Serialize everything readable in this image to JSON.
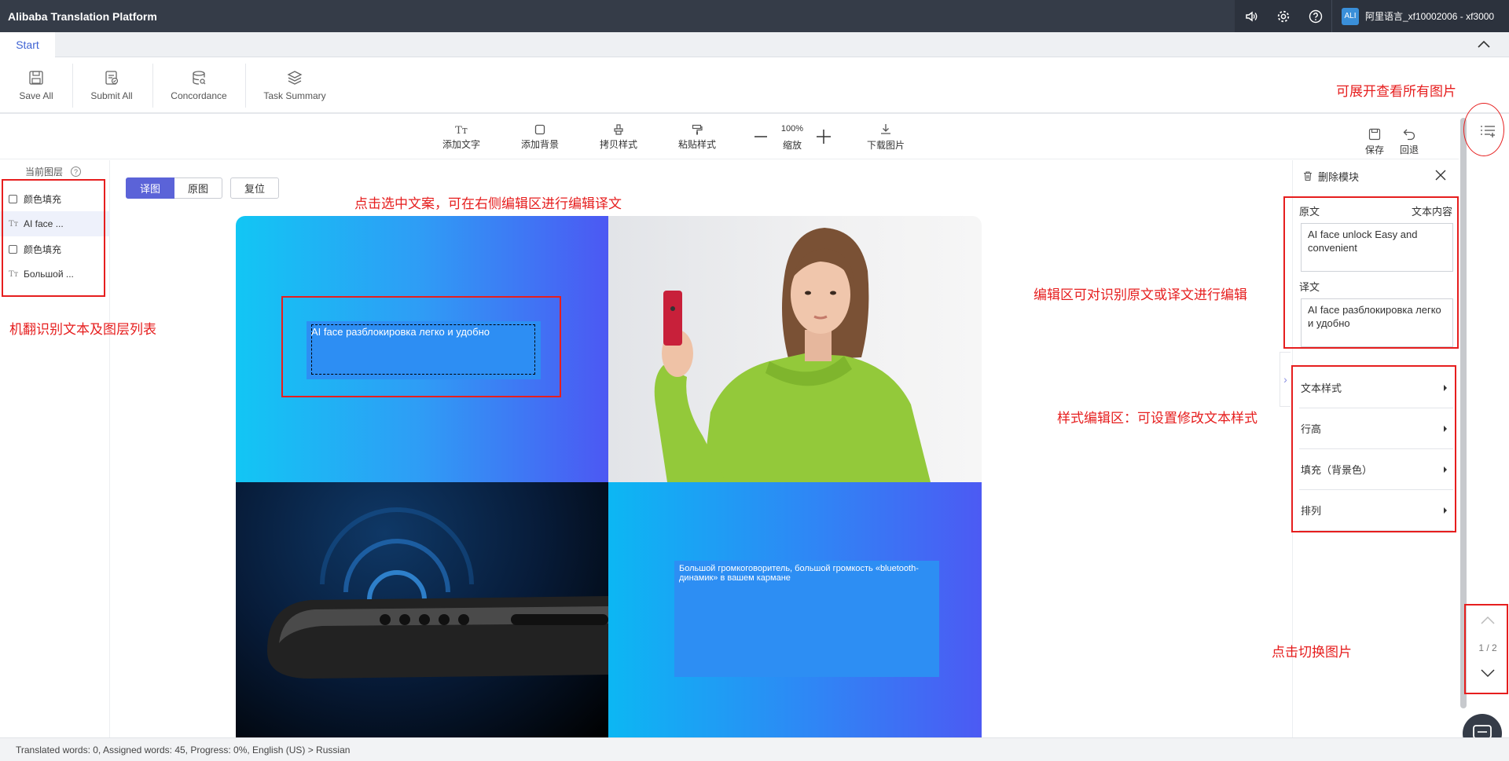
{
  "app": {
    "title": "Alibaba Translation Platform",
    "user": "阿里语言_xf10002006 - xf3000",
    "avatar_text": "ALI"
  },
  "topbar_icons": [
    "speaker-icon",
    "gear-icon",
    "help-icon"
  ],
  "tabs": {
    "start": "Start"
  },
  "toolbar": {
    "save_all": "Save All",
    "submit_all": "Submit All",
    "concordance": "Concordance",
    "task_summary": "Task Summary"
  },
  "editor_toolbar": {
    "add_text": "添加文字",
    "add_background": "添加背景",
    "copy_style": "拷贝样式",
    "paste_style": "粘贴样式",
    "zoom_value": "100%",
    "zoom_label": "缩放",
    "download": "下载图片",
    "save": "保存",
    "undo": "回退"
  },
  "layers": {
    "header": "当前图层",
    "help_glyph": "?",
    "items": [
      {
        "type": "fill",
        "label": "颜色填充"
      },
      {
        "type": "text",
        "label": "AI face ..."
      },
      {
        "type": "fill",
        "label": "颜色填充"
      },
      {
        "type": "text",
        "label": "Большой ..."
      }
    ],
    "text_glyph": "Tт"
  },
  "view_toggle": {
    "edited": "译图",
    "original": "原图",
    "reset": "复位"
  },
  "canvas": {
    "text_1": "AI face разблокировка легко и удобно",
    "text_2": "Большой громкоговоритель, большой громкость «bluetooth-динамик» в вашем кармане"
  },
  "edit_panel": {
    "delete_module": "删除模块",
    "source_label": "原文",
    "source_type": "文本内容",
    "source_text": "AI face unlock Easy and convenient",
    "target_label": "译文",
    "target_text": "AI face разблокировка легко и удобно",
    "sections": [
      "文本样式",
      "行高",
      "填充（背景色）",
      "排列"
    ]
  },
  "pager": {
    "current": "1 / 2"
  },
  "statusbar": "Translated words: 0, Assigned words: 45, Progress: 0%, English (US) > Russian",
  "annotations": {
    "select_text": "点击选中文案，可在右侧编辑区进行编辑译文",
    "layer_list": "机翻识别文本及图层列表",
    "expand_images": "可展开查看所有图片",
    "edit_area": "编辑区可对识别原文或译文进行编辑",
    "style_area": "样式编辑区：可设置修改文本样式",
    "switch_image": "点击切换图片"
  },
  "colors": {
    "annotation": "#e61e1e",
    "accent": "#5b63d8",
    "topbar": "#353c48"
  }
}
